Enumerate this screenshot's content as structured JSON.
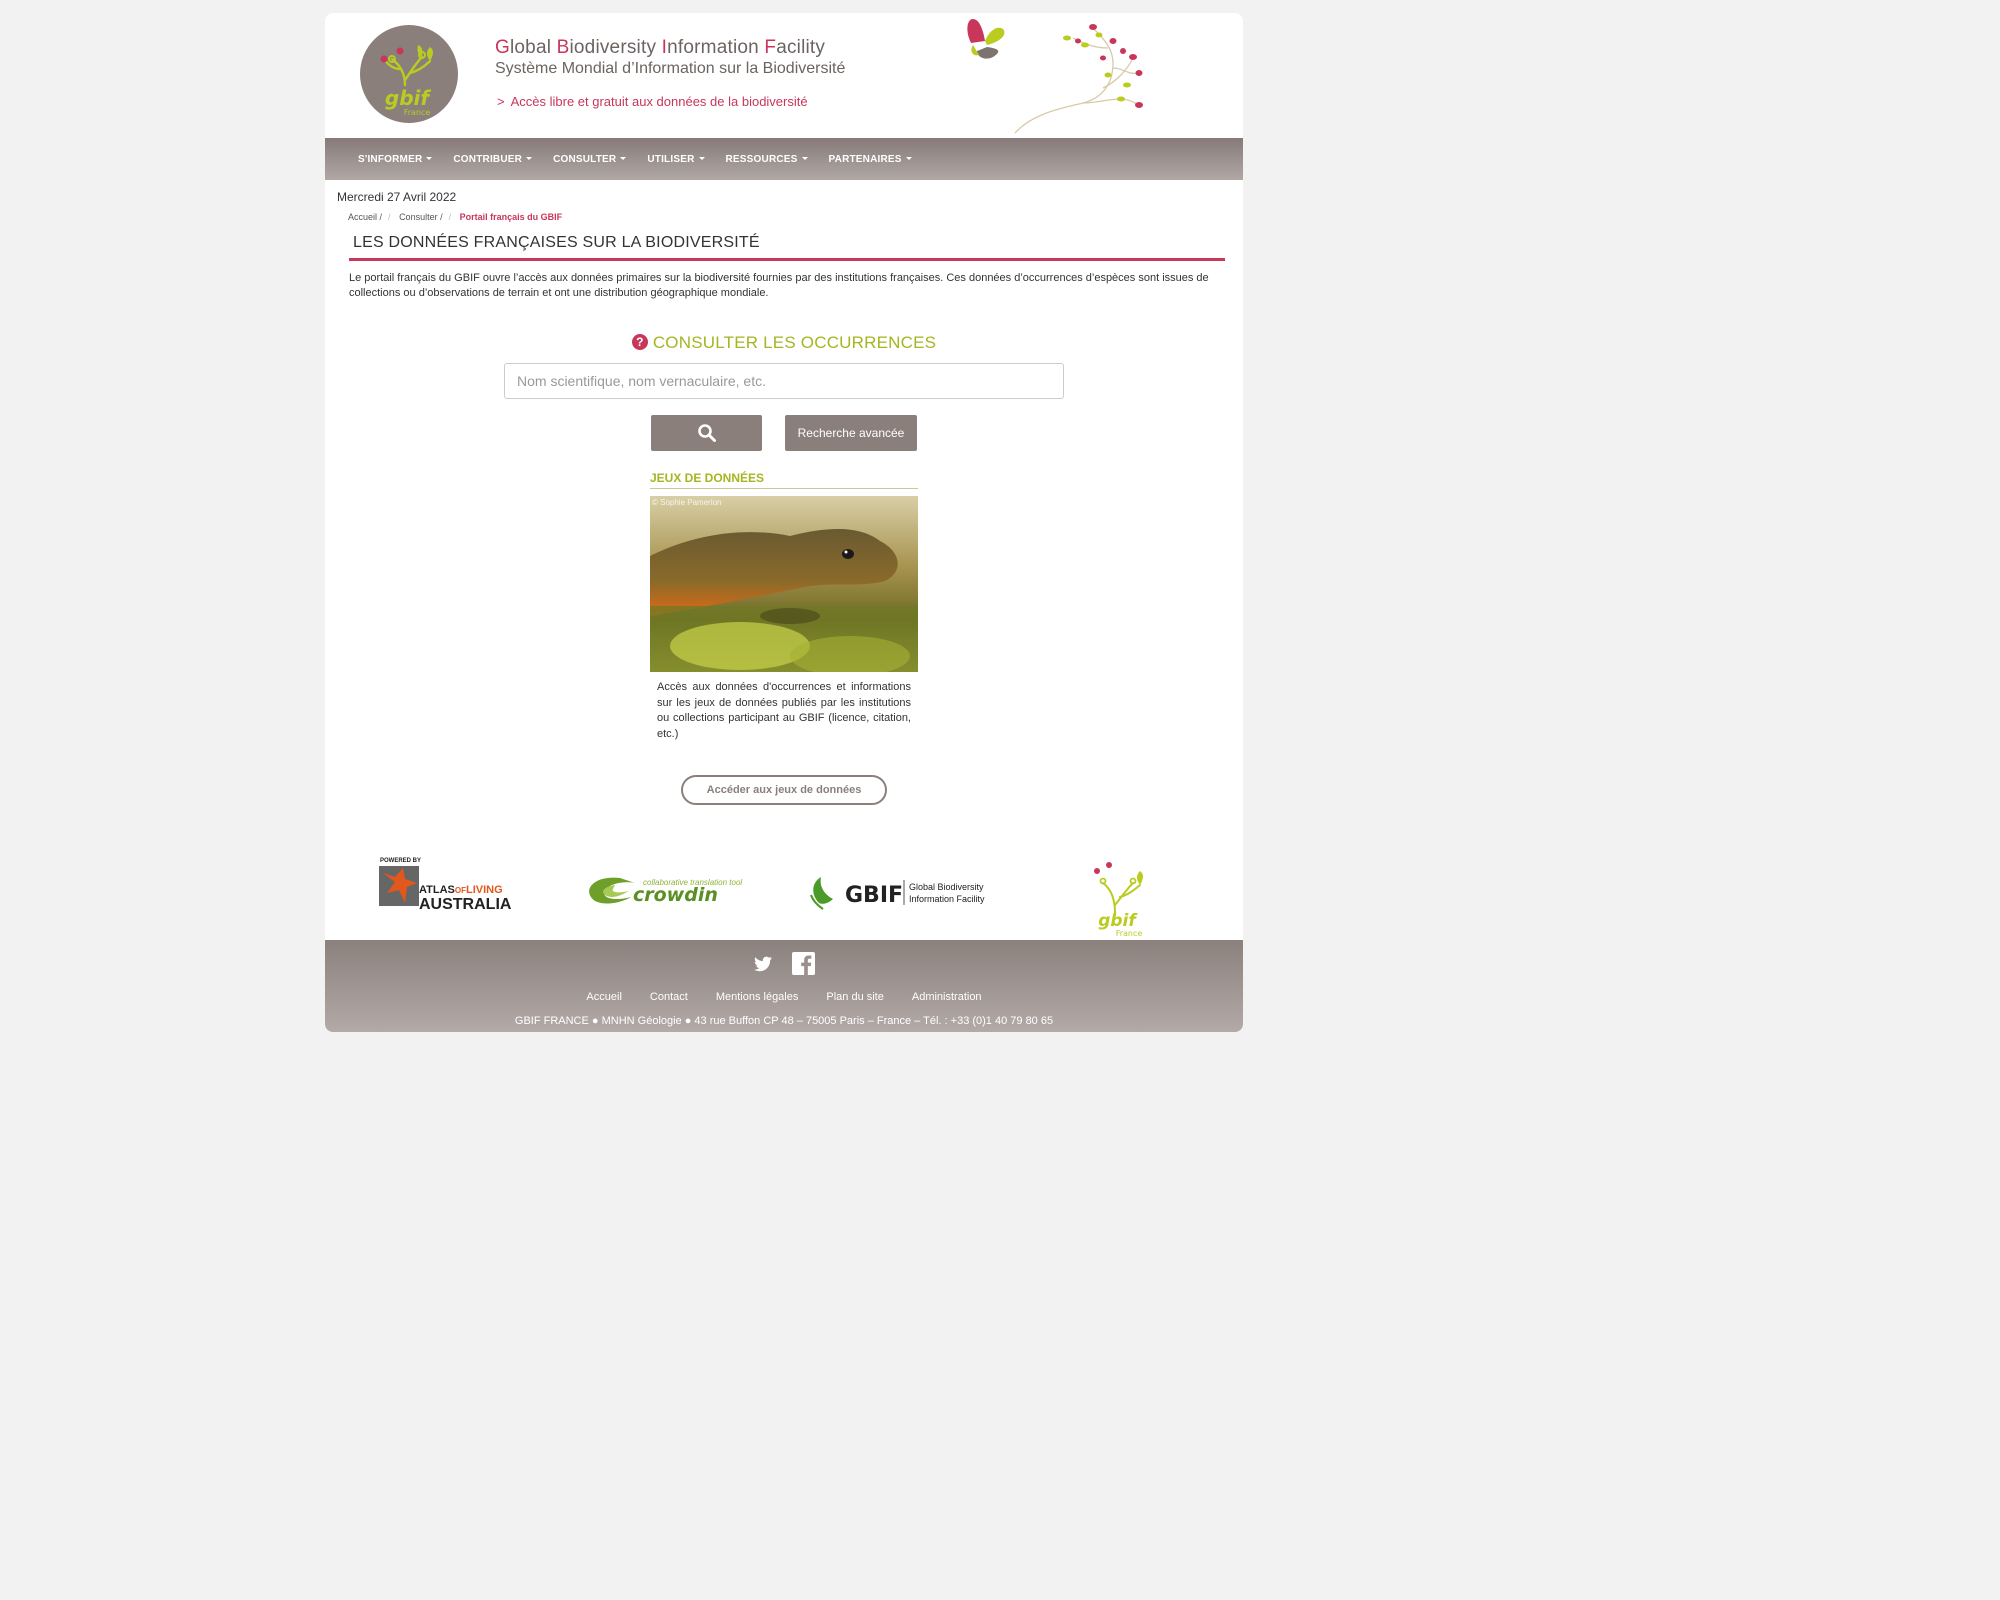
{
  "header": {
    "title_parts": [
      {
        "cap": "G",
        "rest": "lobal "
      },
      {
        "cap": "B",
        "rest": "iodiversity "
      },
      {
        "cap": "I",
        "rest": "nformation "
      },
      {
        "cap": "F",
        "rest": "acility"
      }
    ],
    "subtitle": "Système Mondial d’Information sur la Biodiversité",
    "tagline": "Accès libre et gratuit aux données de la biodiversité",
    "tagline_marker": ">",
    "logo_main": "gbif",
    "logo_sub": "France"
  },
  "nav": {
    "items": [
      "S'INFORMER",
      "CONTRIBUER",
      "CONSULTER",
      "UTILISER",
      "RESSOURCES",
      "PARTENAIRES"
    ]
  },
  "date": "Mercredi 27 Avril 2022",
  "breadcrumb": {
    "items": [
      "Accueil",
      "Consulter",
      "Portail français du GBIF"
    ]
  },
  "main": {
    "section_title": "LES DONNÉES FRANÇAISES SUR LA BIODIVERSITÉ",
    "intro": "Le portail français du GBIF ouvre l’accès aux données primaires sur la biodiversité fournies par des institutions françaises. Ces données d’occurrences d’espèces sont issues de collections ou d’observations de terrain et ont une distribution géographique mondiale.",
    "occ_title": "CONSULTER LES OCCURRENCES",
    "help_symbol": "?",
    "search_placeholder": "Nom scientifique, nom vernaculaire, etc.",
    "advanced_search_label": "Recherche avancée"
  },
  "datasets": {
    "title": "JEUX DE DONNÉES",
    "image_credit": "© Sophie Pamerlon",
    "description": "Accès aux données d'occurrences et informations sur les jeux de données publiés par les institutions ou collections participant au GBIF (licence, citation, etc.)",
    "button_label": "Accéder aux jeux de données"
  },
  "partners": {
    "ala_powered": "POWERED BY",
    "ala_line1_a": "ATLAS",
    "ala_line1_b": "OF",
    "ala_line1_c": "LIVING",
    "ala_line2": "AUSTRALIA",
    "crowdin_tag": "collaborative translation tool",
    "crowdin_name": "crowdin",
    "gbif_name": "GBIF",
    "gbif_full_1": "Global Biodiversity",
    "gbif_full_2": "Information Facility",
    "gbif_france_main": "gbif",
    "gbif_france_sub": "France"
  },
  "footer": {
    "links": [
      "Accueil",
      "Contact",
      "Mentions légales",
      "Plan du site",
      "Administration"
    ],
    "address": "GBIF FRANCE ● MNHN Géologie ● 43 rue Buffon CP 48 – 75005 Paris – France – Tél. : +33 (0)1 40 79 80 65"
  },
  "colors": {
    "accent": "#c8365a",
    "green": "#a6b520",
    "taupe": "#8a7f7b"
  }
}
